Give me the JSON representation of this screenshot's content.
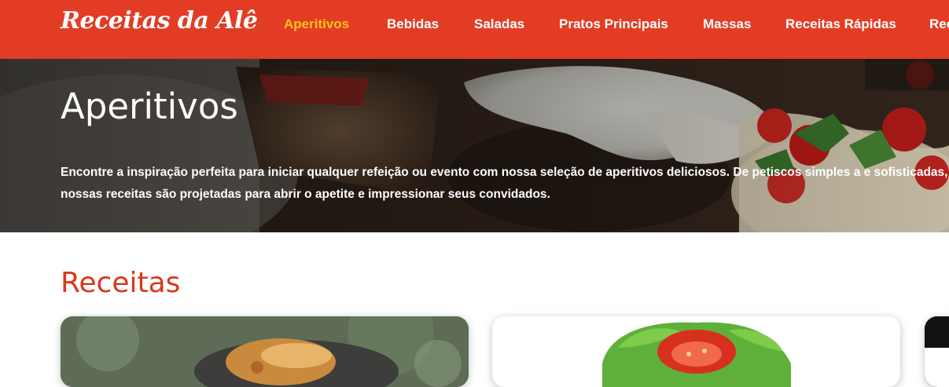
{
  "header": {
    "brand": "Receitas da Alê",
    "nav": [
      {
        "label": "Aperitivos",
        "active": true
      },
      {
        "label": "Bebidas",
        "active": false
      },
      {
        "label": "Saladas",
        "active": false
      },
      {
        "label": "Pratos Principais",
        "active": false
      },
      {
        "label": "Massas",
        "active": false
      },
      {
        "label": "Receitas Rápidas",
        "active": false
      },
      {
        "label": "Rec",
        "active": false
      }
    ],
    "colors": {
      "background": "#e23d24",
      "active": "#ffc21a",
      "text": "#ffffff"
    }
  },
  "hero": {
    "title": "Aperitivos",
    "description": "Encontre a inspiração perfeita para iniciar qualquer refeição ou evento com nossa seleção de aperitivos deliciosos. De petiscos simples a e sofisticadas, nossas receitas são projetadas para abrir o apetite e impressionar seus convidados.",
    "image": "bruschetta-photo"
  },
  "recipes": {
    "title": "Receitas",
    "title_color": "#d9381e",
    "cards": [
      {
        "image": "grilled-appetizer-photo"
      },
      {
        "image": "lettuce-tomato-photo"
      },
      {
        "image": "dark-food-photo"
      }
    ]
  }
}
